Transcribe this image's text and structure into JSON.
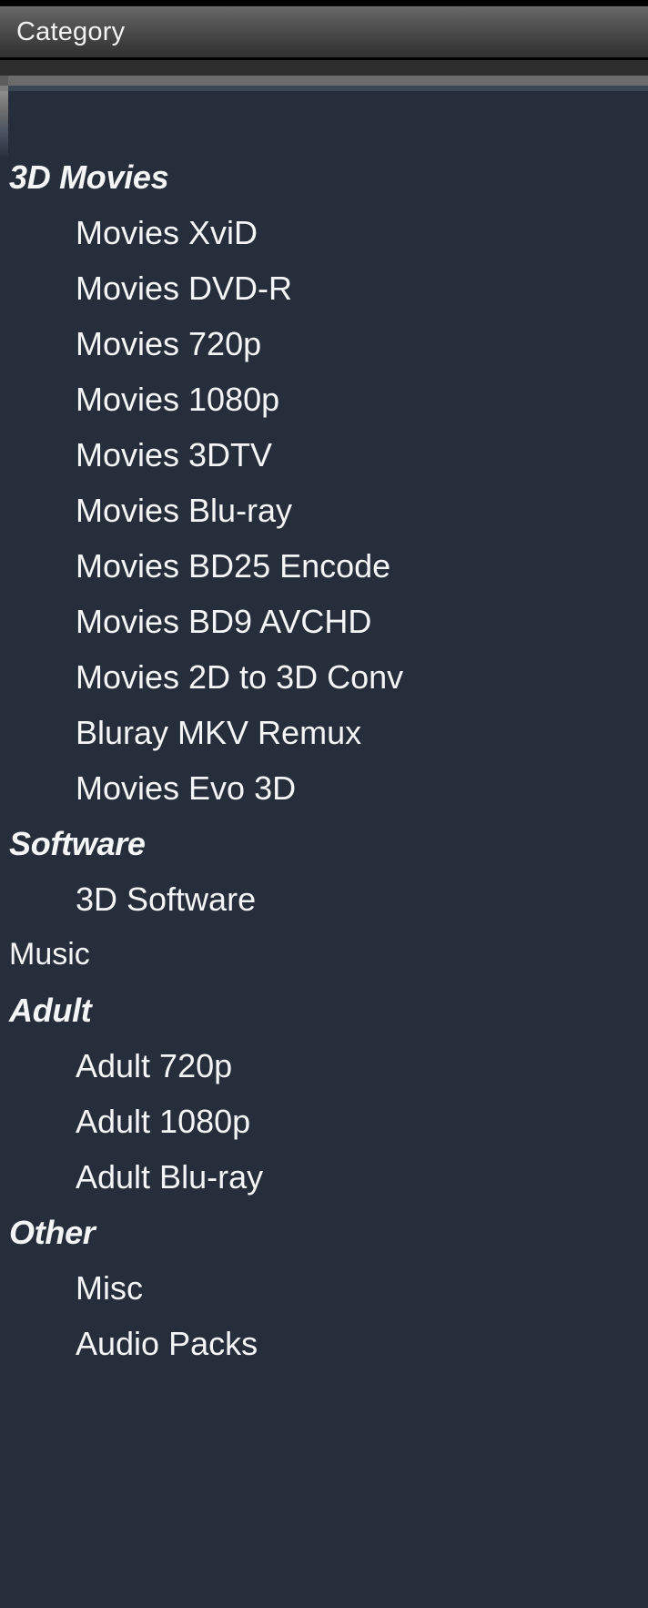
{
  "header": {
    "column_label": "Category"
  },
  "colors": {
    "list_background": "#252e3a",
    "header_gradient_top": "#6a6a6a",
    "header_gradient_bottom": "#323232",
    "text": "#f4f5f6",
    "separator_gray": "#6b6b6b",
    "separator_line": "#3b4654",
    "gap_strip": "#2d2d2d"
  },
  "category_list": {
    "items": [
      {
        "label": "3D Movies",
        "kind": "group"
      },
      {
        "label": "Movies XviD",
        "kind": "child"
      },
      {
        "label": "Movies DVD-R",
        "kind": "child"
      },
      {
        "label": "Movies 720p",
        "kind": "child"
      },
      {
        "label": "Movies 1080p",
        "kind": "child"
      },
      {
        "label": "Movies 3DTV",
        "kind": "child"
      },
      {
        "label": "Movies Blu-ray",
        "kind": "child"
      },
      {
        "label": "Movies BD25 Encode",
        "kind": "child"
      },
      {
        "label": "Movies BD9 AVCHD",
        "kind": "child"
      },
      {
        "label": "Movies 2D to 3D Conv",
        "kind": "child"
      },
      {
        "label": "Bluray MKV Remux",
        "kind": "child"
      },
      {
        "label": "Movies Evo 3D",
        "kind": "child"
      },
      {
        "label": "Software",
        "kind": "group"
      },
      {
        "label": "3D Software",
        "kind": "child"
      },
      {
        "label": "Music",
        "kind": "top"
      },
      {
        "label": "Adult",
        "kind": "group"
      },
      {
        "label": "Adult 720p",
        "kind": "child"
      },
      {
        "label": "Adult 1080p",
        "kind": "child"
      },
      {
        "label": "Adult Blu-ray",
        "kind": "child"
      },
      {
        "label": "Other",
        "kind": "group"
      },
      {
        "label": "Misc",
        "kind": "child"
      },
      {
        "label": "Audio Packs",
        "kind": "child"
      }
    ]
  }
}
